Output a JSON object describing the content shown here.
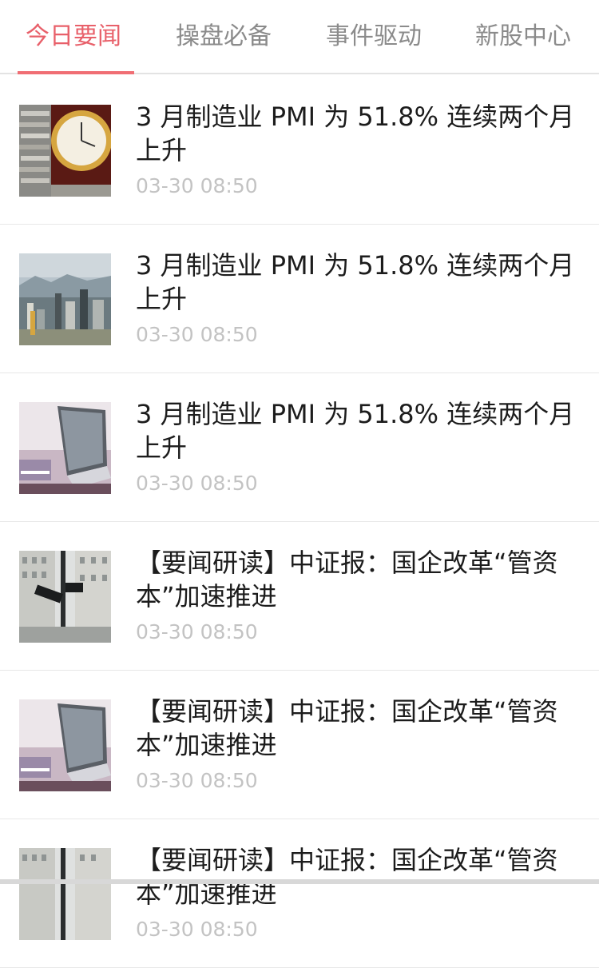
{
  "tabs": [
    {
      "label": "今日要闻",
      "active": true
    },
    {
      "label": "操盘必备",
      "active": false
    },
    {
      "label": "事件驱动",
      "active": false
    },
    {
      "label": "新股中心",
      "active": false
    }
  ],
  "colors": {
    "accent": "#e8606a",
    "time": "#c3c3c3",
    "divider": "#e8e8e8"
  },
  "news": [
    {
      "title": "3 月制造业 PMI 为 51.8% 连续两个月上升",
      "time": "03-30 08:50",
      "thumb": "clock-coins"
    },
    {
      "title": "3 月制造业 PMI 为 51.8% 连续两个月上升",
      "time": "03-30 08:50",
      "thumb": "city-skyline"
    },
    {
      "title": "3 月制造业 PMI 为 51.8% 连续两个月上升",
      "time": "03-30 08:50",
      "thumb": "laptop"
    },
    {
      "title": "【要闻研读】中证报：国企改革“管资本”加速推进",
      "time": "03-30 08:50",
      "thumb": "wall-street"
    },
    {
      "title": "【要闻研读】中证报：国企改革“管资本”加速推进",
      "time": "03-30 08:50",
      "thumb": "laptop"
    },
    {
      "title": "【要闻研读】中证报：国企改革“管资本”加速推进",
      "time": "03-30 08:50",
      "thumb": "wall-street"
    }
  ]
}
